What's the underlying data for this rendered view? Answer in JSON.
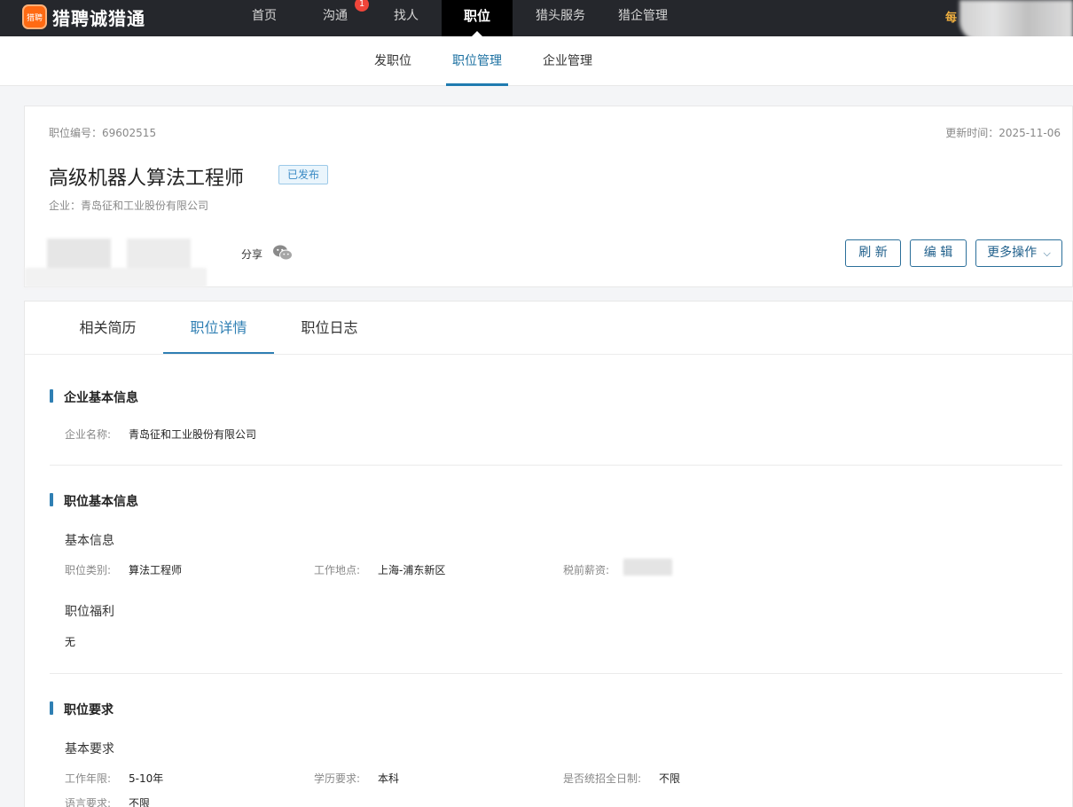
{
  "topbar": {
    "logo_icon_text": "猎聘",
    "brand": "猎聘诚猎通",
    "nav": [
      {
        "label": "首页"
      },
      {
        "label": "沟通",
        "badge": "1"
      },
      {
        "label": "找人"
      },
      {
        "label": "职位"
      },
      {
        "label": "猎头服务"
      },
      {
        "label": "猎企管理"
      }
    ],
    "right_text": "每"
  },
  "subnav": [
    {
      "label": "发职位"
    },
    {
      "label": "职位管理"
    },
    {
      "label": "企业管理"
    }
  ],
  "job": {
    "id_text": "职位编号：69602515",
    "updated_text": "更新时间：2025-11-06",
    "title": "高级机器人算法工程师",
    "status": "已发布",
    "company_text": "企业：青岛征和工业股份有限公司",
    "share_label": "分享"
  },
  "actions": {
    "refresh": "刷 新",
    "edit": "编 辑",
    "more": "更多操作",
    "more_caret": "⌵"
  },
  "tabs": [
    {
      "label": "相关简历"
    },
    {
      "label": "职位详情"
    },
    {
      "label": "职位日志"
    }
  ],
  "sections": {
    "company": {
      "title": "企业基本信息",
      "name_label": "企业名称:",
      "name_value": "青岛征和工业股份有限公司"
    },
    "basic": {
      "title": "职位基本信息",
      "sub1": "基本信息",
      "category_label": "职位类别:",
      "category_value": "算法工程师",
      "location_label": "工作地点:",
      "location_value": "上海-浦东新区",
      "salary_label": "税前薪资:",
      "sub2": "职位福利",
      "welfare_value": "无"
    },
    "requirements": {
      "title": "职位要求",
      "sub1": "基本要求",
      "years_label": "工作年限:",
      "years_value": "5-10年",
      "edu_label": "学历要求:",
      "edu_value": "本科",
      "fulltime_label": "是否统招全日制:",
      "fulltime_value": "不限",
      "lang_label": "语言要求:",
      "lang_value": "不限"
    }
  },
  "colors": {
    "topbar_bg": "#25272c",
    "accent": "#2f7fb3",
    "status_text": "#3a8ac4",
    "badge": "#f0453a",
    "logo": "#ff6a13"
  }
}
